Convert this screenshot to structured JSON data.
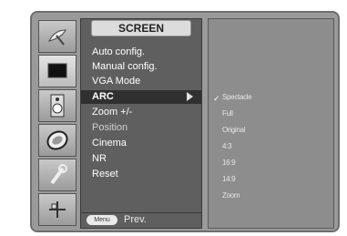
{
  "icons": [
    "satellite-dish-icon",
    "monitor-icon",
    "speaker-icon",
    "clock-icon",
    "wrench-icon",
    "pip-icon"
  ],
  "menu": {
    "title": "SCREEN",
    "items": [
      "Auto config.",
      "Manual config.",
      "VGA Mode",
      "ARC",
      "Zoom +/-",
      "Position",
      "Cinema",
      "NR",
      "Reset"
    ],
    "selected_index": 3
  },
  "submenu": {
    "checkmark": "✓",
    "options": [
      "Spectacle",
      "Full",
      "Original",
      "4:3",
      "16:9",
      "14:9",
      "Zoom"
    ]
  },
  "footer": {
    "key_label": "Menu",
    "prev_label": "Prev."
  }
}
